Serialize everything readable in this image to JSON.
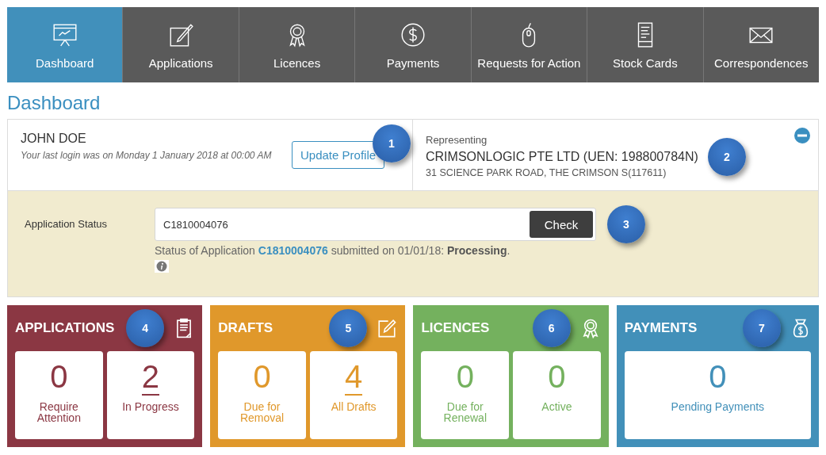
{
  "nav": [
    {
      "label": "Dashboard",
      "selected": true
    },
    {
      "label": "Applications",
      "selected": false
    },
    {
      "label": "Licences",
      "selected": false
    },
    {
      "label": "Payments",
      "selected": false
    },
    {
      "label": "Requests for Action",
      "selected": false
    },
    {
      "label": "Stock Cards",
      "selected": false
    },
    {
      "label": "Correspondences",
      "selected": false
    }
  ],
  "page_title": "Dashboard",
  "profile": {
    "name": "JOHN DOE",
    "last_login": "Your last login was on Monday 1 January 2018 at 00:00 AM",
    "button": "Update Profile",
    "callout": "1"
  },
  "representing": {
    "label": "Representing",
    "company": "CRIMSONLOGIC PTE LTD (UEN: 198800784N)",
    "address": "31 SCIENCE PARK ROAD, THE CRIMSON S(117611)",
    "callout": "2",
    "expanded": true
  },
  "status": {
    "label": "Application Status",
    "value": "C1810004076",
    "button": "Check",
    "callout": "3",
    "message_before": "Status of Application ",
    "message_link": "C1810004076",
    "message_after": " submitted on 01/01/18: **Processing**."
  },
  "cards": [
    {
      "title": "APPLICATIONS",
      "color": "#8b3743",
      "callout": "4",
      "stats": [
        {
          "value": "0",
          "label": "Require Attention",
          "link": false
        },
        {
          "value": "2",
          "label": "In Progress",
          "link": true
        }
      ]
    },
    {
      "title": "DRAFTS",
      "color": "#e0982b",
      "callout": "5",
      "stats": [
        {
          "value": "0",
          "label": "Due for Removal",
          "link": false
        },
        {
          "value": "4",
          "label": "All Drafts",
          "link": true
        }
      ]
    },
    {
      "title": "LICENCES",
      "color": "#74b15e",
      "callout": "6",
      "stats": [
        {
          "value": "0",
          "label": "Due for Renewal",
          "link": false
        },
        {
          "value": "0",
          "label": "Active",
          "link": false
        }
      ]
    },
    {
      "title": "PAYMENTS",
      "color": "#4290b9",
      "callout": "7",
      "stats": [
        {
          "value": "0",
          "label": "Pending Payments",
          "link": false
        }
      ]
    }
  ]
}
